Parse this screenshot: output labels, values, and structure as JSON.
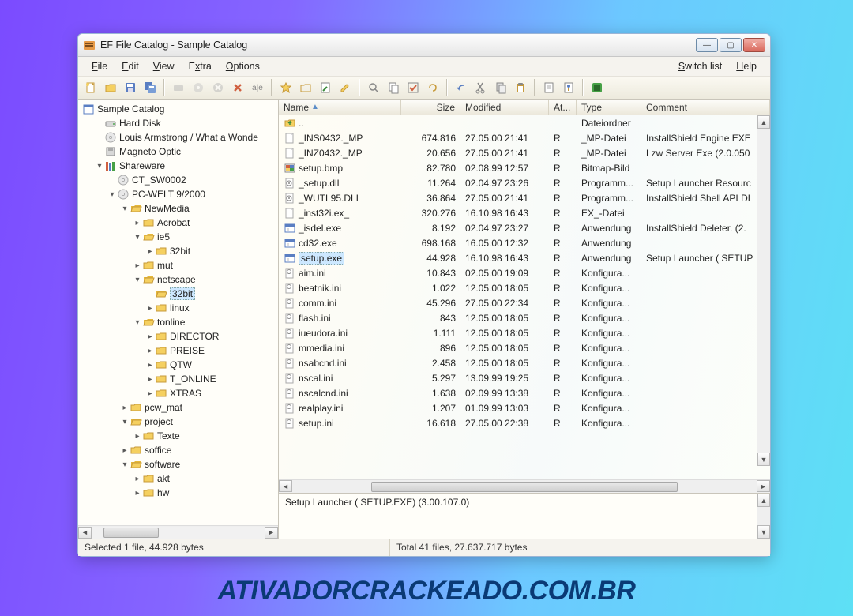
{
  "watermark": "ATIVADORCRACKEADO.COM.BR",
  "window": {
    "title": "EF File Catalog - Sample Catalog"
  },
  "menu": {
    "file": "File",
    "edit": "Edit",
    "view": "View",
    "extra": "Extra",
    "options": "Options",
    "switch": "Switch list",
    "help": "Help"
  },
  "tree": {
    "root": "Sample Catalog",
    "items": [
      {
        "label": "Hard Disk",
        "icon": "drive"
      },
      {
        "label": "Louis Armstrong / What a Wonde",
        "icon": "cd"
      },
      {
        "label": "Magneto Optic",
        "icon": "disk"
      },
      {
        "label": "Shareware",
        "icon": "books",
        "expanded": true,
        "children": [
          {
            "label": "CT_SW0002",
            "icon": "cd"
          },
          {
            "label": "PC-WELT 9/2000",
            "icon": "cd",
            "expanded": true,
            "children": [
              {
                "label": "NewMedia",
                "icon": "folder-open",
                "expanded": true,
                "children": [
                  {
                    "label": "Acrobat",
                    "icon": "folder",
                    "leaf": true
                  },
                  {
                    "label": "ie5",
                    "icon": "folder-open",
                    "expanded": true,
                    "children": [
                      {
                        "label": "32bit",
                        "icon": "folder",
                        "leaf": true
                      }
                    ]
                  },
                  {
                    "label": "mut",
                    "icon": "folder",
                    "leaf": true
                  },
                  {
                    "label": "netscape",
                    "icon": "folder-open",
                    "expanded": true,
                    "children": [
                      {
                        "label": "32bit",
                        "icon": "folder-open",
                        "selected": true
                      },
                      {
                        "label": "linux",
                        "icon": "folder",
                        "leaf": true
                      }
                    ]
                  },
                  {
                    "label": "tonline",
                    "icon": "folder-open",
                    "expanded": true,
                    "children": [
                      {
                        "label": "DIRECTOR",
                        "icon": "folder",
                        "leaf": true
                      },
                      {
                        "label": "PREISE",
                        "icon": "folder",
                        "leaf": true
                      },
                      {
                        "label": "QTW",
                        "icon": "folder",
                        "leaf": true
                      },
                      {
                        "label": "T_ONLINE",
                        "icon": "folder",
                        "leaf": true
                      },
                      {
                        "label": "XTRAS",
                        "icon": "folder",
                        "leaf": true
                      }
                    ]
                  }
                ]
              },
              {
                "label": "pcw_mat",
                "icon": "folder",
                "leaf": true
              },
              {
                "label": "project",
                "icon": "folder-open",
                "expanded": true,
                "children": [
                  {
                    "label": "Texte",
                    "icon": "folder",
                    "leaf": true
                  }
                ]
              },
              {
                "label": "soffice",
                "icon": "folder",
                "leaf": true
              },
              {
                "label": "software",
                "icon": "folder-open",
                "expanded": true,
                "children": [
                  {
                    "label": "akt",
                    "icon": "folder",
                    "leaf": true
                  },
                  {
                    "label": "hw",
                    "icon": "folder",
                    "leaf": true
                  }
                ]
              }
            ]
          }
        ]
      }
    ]
  },
  "columns": {
    "name": "Name",
    "size": "Size",
    "modified": "Modified",
    "attr": "At...",
    "type": "Type",
    "comment": "Comment"
  },
  "files": [
    {
      "icon": "up",
      "name": "..",
      "size": "",
      "mod": "",
      "attr": "",
      "type": "Dateiordner",
      "comment": ""
    },
    {
      "icon": "doc",
      "name": "_INS0432._MP",
      "size": "674.816",
      "mod": "27.05.00 21:41",
      "attr": "R",
      "type": "_MP-Datei",
      "comment": "InstallShield Engine EXE "
    },
    {
      "icon": "doc",
      "name": "_INZ0432._MP",
      "size": "20.656",
      "mod": "27.05.00 21:41",
      "attr": "R",
      "type": "_MP-Datei",
      "comment": "Lzw Server Exe (2.0.050"
    },
    {
      "icon": "bmp",
      "name": "setup.bmp",
      "size": "82.780",
      "mod": "02.08.99 12:57",
      "attr": "R",
      "type": "Bitmap-Bild",
      "comment": ""
    },
    {
      "icon": "dll",
      "name": "_setup.dll",
      "size": "11.264",
      "mod": "02.04.97 23:26",
      "attr": "R",
      "type": "Programm...",
      "comment": "Setup Launcher Resourc"
    },
    {
      "icon": "dll",
      "name": "_WUTL95.DLL",
      "size": "36.864",
      "mod": "27.05.00 21:41",
      "attr": "R",
      "type": "Programm...",
      "comment": "InstallShield Shell API DL"
    },
    {
      "icon": "doc",
      "name": "_inst32i.ex_",
      "size": "320.276",
      "mod": "16.10.98 16:43",
      "attr": "R",
      "type": "EX_-Datei",
      "comment": ""
    },
    {
      "icon": "exe",
      "name": "_isdel.exe",
      "size": "8.192",
      "mod": "02.04.97 23:27",
      "attr": "R",
      "type": "Anwendung",
      "comment": "InstallShield Deleter.  (2."
    },
    {
      "icon": "exe",
      "name": "cd32.exe",
      "size": "698.168",
      "mod": "16.05.00 12:32",
      "attr": "R",
      "type": "Anwendung",
      "comment": ""
    },
    {
      "icon": "exe",
      "name": "setup.exe",
      "size": "44.928",
      "mod": "16.10.98 16:43",
      "attr": "R",
      "type": "Anwendung",
      "comment": "Setup Launcher ( SETUP",
      "selected": true
    },
    {
      "icon": "ini",
      "name": "aim.ini",
      "size": "10.843",
      "mod": "02.05.00 19:09",
      "attr": "R",
      "type": "Konfigura...",
      "comment": ""
    },
    {
      "icon": "ini",
      "name": "beatnik.ini",
      "size": "1.022",
      "mod": "12.05.00 18:05",
      "attr": "R",
      "type": "Konfigura...",
      "comment": ""
    },
    {
      "icon": "ini",
      "name": "comm.ini",
      "size": "45.296",
      "mod": "27.05.00 22:34",
      "attr": "R",
      "type": "Konfigura...",
      "comment": ""
    },
    {
      "icon": "ini",
      "name": "flash.ini",
      "size": "843",
      "mod": "12.05.00 18:05",
      "attr": "R",
      "type": "Konfigura...",
      "comment": ""
    },
    {
      "icon": "ini",
      "name": "iueudora.ini",
      "size": "1.111",
      "mod": "12.05.00 18:05",
      "attr": "R",
      "type": "Konfigura...",
      "comment": ""
    },
    {
      "icon": "ini",
      "name": "mmedia.ini",
      "size": "896",
      "mod": "12.05.00 18:05",
      "attr": "R",
      "type": "Konfigura...",
      "comment": ""
    },
    {
      "icon": "ini",
      "name": "nsabcnd.ini",
      "size": "2.458",
      "mod": "12.05.00 18:05",
      "attr": "R",
      "type": "Konfigura...",
      "comment": ""
    },
    {
      "icon": "ini",
      "name": "nscal.ini",
      "size": "5.297",
      "mod": "13.09.99 19:25",
      "attr": "R",
      "type": "Konfigura...",
      "comment": ""
    },
    {
      "icon": "ini",
      "name": "nscalcnd.ini",
      "size": "1.638",
      "mod": "02.09.99 13:38",
      "attr": "R",
      "type": "Konfigura...",
      "comment": ""
    },
    {
      "icon": "ini",
      "name": "realplay.ini",
      "size": "1.207",
      "mod": "01.09.99 13:03",
      "attr": "R",
      "type": "Konfigura...",
      "comment": ""
    },
    {
      "icon": "ini",
      "name": "setup.ini",
      "size": "16.618",
      "mod": "27.05.00 22:38",
      "attr": "R",
      "type": "Konfigura...",
      "comment": ""
    }
  ],
  "detail": "Setup Launcher ( SETUP.EXE)  (3.00.107.0)",
  "status": {
    "left": "Selected 1 file, 44.928 bytes",
    "right": "Total 41 files, 27.637.717 bytes"
  }
}
